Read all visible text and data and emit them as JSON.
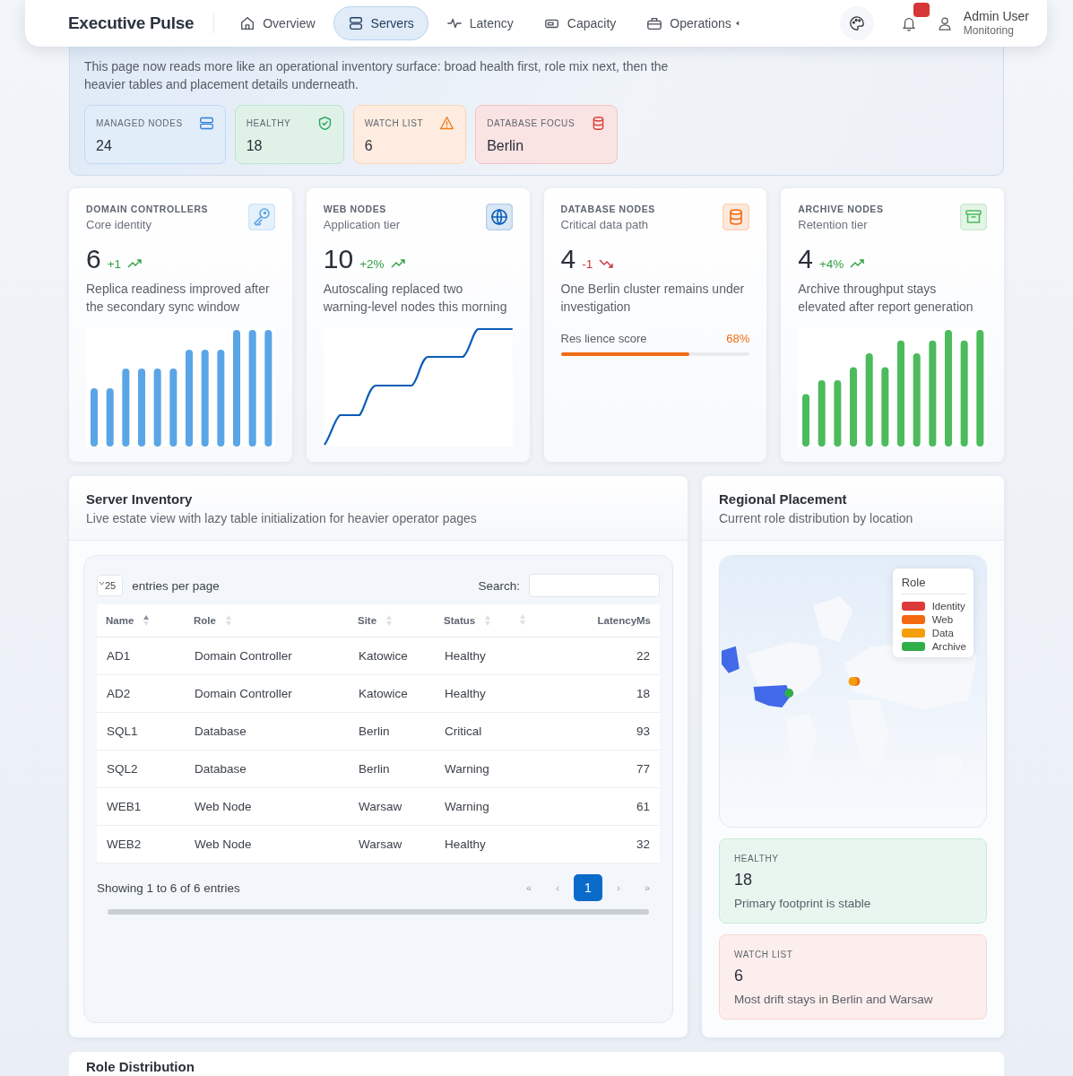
{
  "nav": {
    "brand": "Executive Pulse",
    "items": [
      {
        "label": "Overview",
        "selected": false
      },
      {
        "label": "Servers",
        "selected": true
      },
      {
        "label": "Latency",
        "selected": false
      },
      {
        "label": "Capacity",
        "selected": false
      },
      {
        "label": "Operations",
        "selected": false
      }
    ],
    "alert": true,
    "user": {
      "name": "Admin User",
      "role": "Monitoring"
    }
  },
  "hero": {
    "text": "This page now reads more like an operational inventory surface: broad health first, role mix next, then the heavier tables and placement details underneath.",
    "chips": [
      {
        "label": "MANAGED NODES",
        "value": "24",
        "color": "#2f7fd8"
      },
      {
        "label": "HEALTHY",
        "value": "18",
        "color": "#22a55a"
      },
      {
        "label": "WATCH LIST",
        "value": "6",
        "color": "#f07a1a"
      },
      {
        "label": "DATABASE FOCUS",
        "value": "Berlin",
        "color": "#dc3a3a"
      }
    ]
  },
  "nodes": [
    {
      "title": "DOMAIN CONTROLLERS",
      "subtitle": "Core identity",
      "count": "6",
      "delta": "+1",
      "rising": true,
      "note": "Replica readiness improved after the secondary sync window",
      "kind": "bars",
      "color": "#5aa5e6"
    },
    {
      "title": "WEB NODES",
      "subtitle": "Application tier",
      "count": "10",
      "delta": "+2%",
      "rising": true,
      "note": "Autoscaling replaced two warning-level nodes this morning",
      "kind": "line",
      "color": "#0a5cb8"
    },
    {
      "title": "DATABASE NODES",
      "subtitle": "Critical data path",
      "count": "4",
      "delta": "-1",
      "rising": false,
      "note": "One Berlin cluster remains under investigation",
      "kind": "progress",
      "color": "#f06a12",
      "progress": {
        "label": "Res lience score",
        "reading": "68%",
        "level": 0.68
      }
    },
    {
      "title": "ARCHIVE NODES",
      "subtitle": "Retention tier",
      "count": "4",
      "delta": "+4%",
      "rising": true,
      "note": "Archive throughput stays elevated after report generation",
      "kind": "bars",
      "color": "#4cbb5c"
    }
  ],
  "inventory": {
    "title": "Server Inventory",
    "subtitle": "Live estate view with lazy table initialization for heavier operator pages",
    "length": "25",
    "length_label": "entries per page",
    "search_label": "Search:",
    "columns": [
      {
        "label": "Name",
        "sorted": true
      },
      {
        "label": "Role",
        "sorted": false
      },
      {
        "label": "Site",
        "sorted": false
      },
      {
        "label": "Status",
        "sorted": false
      },
      {
        "sorted": false
      },
      {
        "label": "LatencyMs"
      }
    ],
    "rows": [
      [
        "AD1",
        "Domain Controller",
        "Katowice",
        "Healthy",
        "",
        "22"
      ],
      [
        "AD2",
        "Domain Controller",
        "Katowice",
        "Healthy",
        "",
        "18"
      ],
      [
        "SQL1",
        "Database",
        "Berlin",
        "Critical",
        "",
        "93"
      ],
      [
        "SQL2",
        "Database",
        "Berlin",
        "Warning",
        "",
        "77"
      ],
      [
        "WEB1",
        "Web Node",
        "Warsaw",
        "Warning",
        "",
        "61"
      ],
      [
        "WEB2",
        "Web Node",
        "Warsaw",
        "Healthy",
        "",
        "32"
      ]
    ],
    "info": "Showing 1 to 6 of 6 entries",
    "pages": [
      {
        "label": "«",
        "selected": false
      },
      {
        "label": "‹",
        "selected": false
      },
      {
        "label": "1",
        "selected": true
      },
      {
        "label": "›",
        "selected": false
      },
      {
        "label": "»",
        "selected": false
      }
    ]
  },
  "regional": {
    "title": "Regional Placement",
    "subtitle": "Current role distribution by location",
    "legend": {
      "title": "Role",
      "items": [
        {
          "label": "Identity",
          "color": "#dc3a3a"
        },
        {
          "label": "Web",
          "color": "#f4680f"
        },
        {
          "label": "Data",
          "color": "#f59e0b"
        },
        {
          "label": "Archive",
          "color": "#2fae4a"
        }
      ]
    },
    "stats": [
      {
        "label": "HEALTHY",
        "value": "18",
        "note": "Primary footprint is stable"
      },
      {
        "label": "WATCH LIST",
        "value": "6",
        "note": "Most drift stays in Berlin and Warsaw"
      }
    ]
  },
  "distribution": {
    "title": "Role Distribution"
  }
}
